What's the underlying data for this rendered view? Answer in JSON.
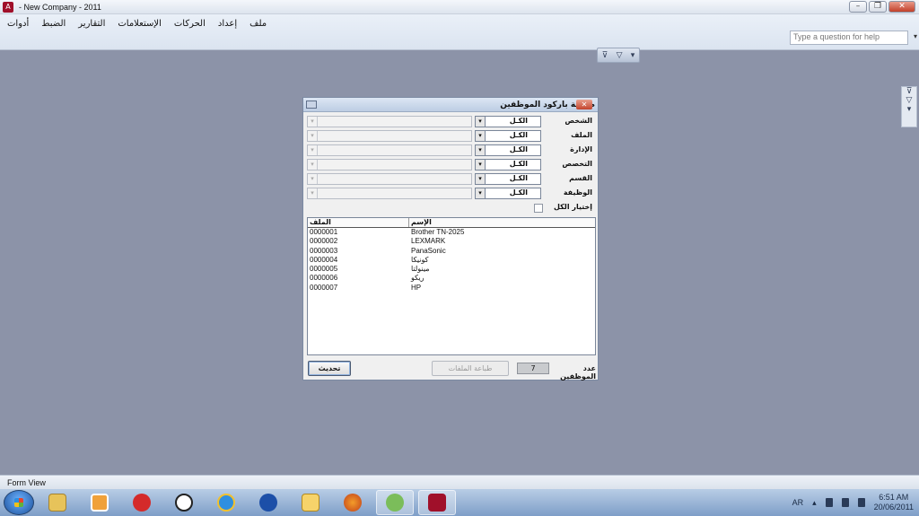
{
  "window": {
    "title": "- New Company - 2011"
  },
  "menu": [
    "ملف",
    "إعداد",
    "الحركات",
    "الإستعلامات",
    "التقارير",
    "الضبط",
    "أدوات"
  ],
  "help": {
    "placeholder": "Type a question for help"
  },
  "dialog": {
    "title": "طباعة باركود الموظفين",
    "fields": [
      {
        "label": "الشخص",
        "value": "الكـل"
      },
      {
        "label": "الملف",
        "value": "الكـل"
      },
      {
        "label": "الإدارة",
        "value": "الكـل"
      },
      {
        "label": "التخصص",
        "value": "الكـل"
      },
      {
        "label": "القسم",
        "value": "الكـل"
      },
      {
        "label": "الوظيفة",
        "value": "الكـل"
      }
    ],
    "select_all_label": "إختيار الكل",
    "list": {
      "headers": [
        "الملف",
        "الإسم"
      ],
      "rows": [
        [
          "0000001",
          "Brother TN-2025"
        ],
        [
          "0000002",
          "LEXMARK"
        ],
        [
          "0000003",
          "PanaSonic"
        ],
        [
          "0000004",
          "كونيكا"
        ],
        [
          "0000005",
          "مينولتا"
        ],
        [
          "0000006",
          "ريكو"
        ],
        [
          "0000007",
          "HP"
        ]
      ]
    },
    "refresh_label": "تحديث",
    "print_label": "طباعة الملفات",
    "count_value": "7",
    "count_label": "عدد الموظفين"
  },
  "status": {
    "view": "Form View"
  },
  "taskbar": {
    "icons": [
      "explorer-icon",
      "media-player-icon",
      "pushpin-icon",
      "clock-icon",
      "internet-explorer-icon",
      "messenger-icon",
      "mail-icon",
      "firefox-icon",
      "network-users-icon",
      "access-icon"
    ],
    "lang": "AR",
    "time": "6:51 AM",
    "date": "20/06/2011"
  }
}
